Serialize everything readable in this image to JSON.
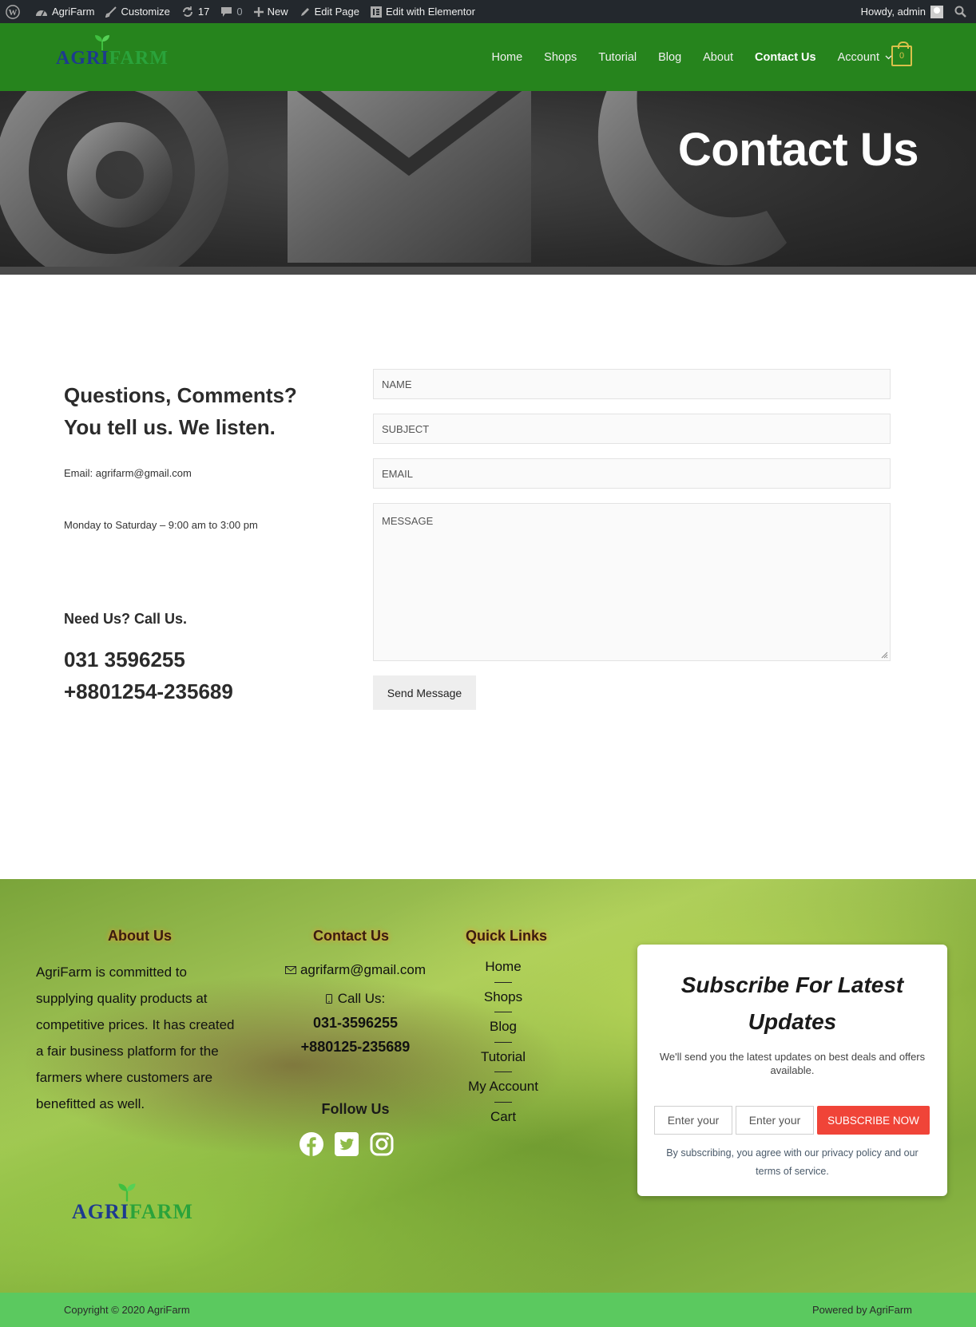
{
  "adminbar": {
    "site": "AgriFarm",
    "customize": "Customize",
    "updates": "17",
    "comments": "0",
    "new": "New",
    "edit_page": "Edit Page",
    "elementor": "Edit with Elementor",
    "howdy": "Howdy, admin"
  },
  "header": {
    "logo_a": "AGRI",
    "logo_b": "FARM",
    "nav": [
      "Home",
      "Shops",
      "Tutorial",
      "Blog",
      "About",
      "Contact Us",
      "Account"
    ],
    "cart_count": "0"
  },
  "hero": {
    "title": "Contact Us"
  },
  "contact": {
    "heading": "Questions, Comments? You tell us. We listen.",
    "email": "Email: agrifarm@gmail.com",
    "hours": "Monday to Saturday – 9:00 am to 3:00 pm",
    "need_us": "Need Us? Call Us.",
    "phone1": "031 3596255",
    "phone2": "+8801254-235689"
  },
  "form": {
    "name_placeholder": "NAME",
    "subject_placeholder": "SUBJECT",
    "email_placeholder": "EMAIL",
    "message_placeholder": "MESSAGE",
    "send": "Send Message"
  },
  "footer": {
    "about_title": "About Us",
    "about_text": "AgriFarm is committed to supplying quality products at competitive prices. It has created a fair business platform for the farmers where customers are benefitted as well.",
    "contact_title": "Contact Us",
    "contact_email": "agrifarm@gmail.com",
    "call_label": "Call Us:",
    "phone1": "031-3596255",
    "phone2": "+880125-235689",
    "follow_title": "Follow Us",
    "quick_title": "Quick Links",
    "quick_links": [
      "Home",
      "Shops",
      "Blog",
      "Tutorial",
      "My Account",
      "Cart"
    ],
    "logo_a": "AGRI",
    "logo_b": "FARM"
  },
  "subscribe": {
    "title": "Subscribe For Latest Updates",
    "desc": "We'll send you the latest updates on best deals and offers available.",
    "input1": "Enter your",
    "input2": "Enter your",
    "button": "SUBSCRIBE NOW",
    "note": "By subscribing, you agree with our privacy policy and our terms of service."
  },
  "copyright": {
    "left": "Copyright © 2020 AgriFarm",
    "right": "Powered by AgriFarm"
  },
  "colors": {
    "header_green": "#1f8016",
    "copy_green": "#5bc95f",
    "subscribe_red": "#f04438"
  }
}
